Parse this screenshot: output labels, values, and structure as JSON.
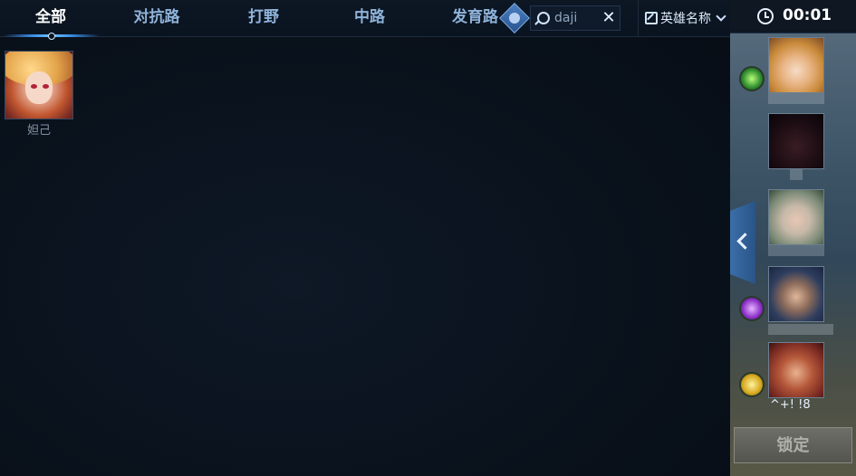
{
  "tabs": [
    {
      "label": "全部",
      "active": true
    },
    {
      "label": "对抗路",
      "active": false
    },
    {
      "label": "打野",
      "active": false
    },
    {
      "label": "中路",
      "active": false
    },
    {
      "label": "发育路",
      "active": false
    }
  ],
  "search": {
    "value": "daji",
    "icon": "search-icon",
    "clear_icon": "close-icon",
    "clear_glyph": "✕"
  },
  "sort": {
    "selected": "英雄名称",
    "icon": "edit-icon"
  },
  "heroes": [
    {
      "name": "妲己"
    }
  ],
  "right_panel": {
    "timer": "00:01",
    "stats_text": "^+! !8",
    "lock_label": "锁定",
    "slots": [
      {
        "spell": "spell-green-icon"
      },
      {
        "spell": ""
      },
      {
        "spell": ""
      },
      {
        "spell": "spell-purple-icon"
      },
      {
        "spell": "spell-gold-icon"
      }
    ]
  },
  "colors": {
    "accent": "#3a8de6",
    "active_tab": "#ffffff",
    "inactive_tab": "#8fb3d9",
    "background": "#0b121c"
  }
}
